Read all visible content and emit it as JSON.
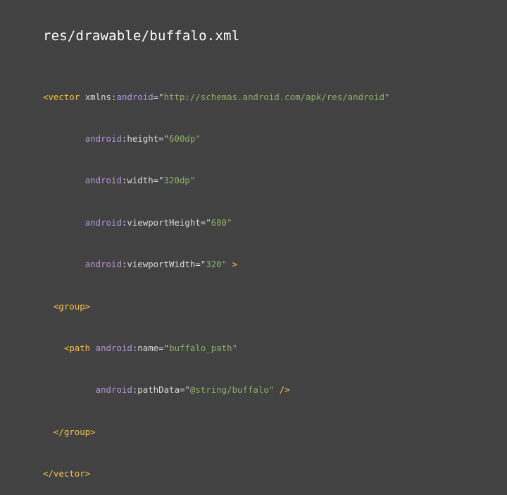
{
  "title": "res/drawable/buffalo.xml",
  "code": {
    "vector_open": "<vector",
    "xmlns": "xmlns:",
    "android_ns": "android",
    "eq_q": "=\"",
    "q": "\"",
    "xmlns_value": "http://schemas.android.com/apk/res/android",
    "height_attr": ":height",
    "height_value": "600dp",
    "width_attr": ":width",
    "width_value": "320dp",
    "vph_attr": ":viewportHeight",
    "vph_value": "600",
    "vpw_attr": ":viewportWidth",
    "vpw_value": "320",
    "close_bracket": " >",
    "group_open": "<group>",
    "path_open": "<path",
    "name_attr": ":name",
    "name_value": "buffalo_path",
    "pathdata_attr": ":pathData",
    "pathdata_value": "@string/buffalo",
    "self_close": " />",
    "group_close": "</group>",
    "vector_close": "</vector>"
  }
}
